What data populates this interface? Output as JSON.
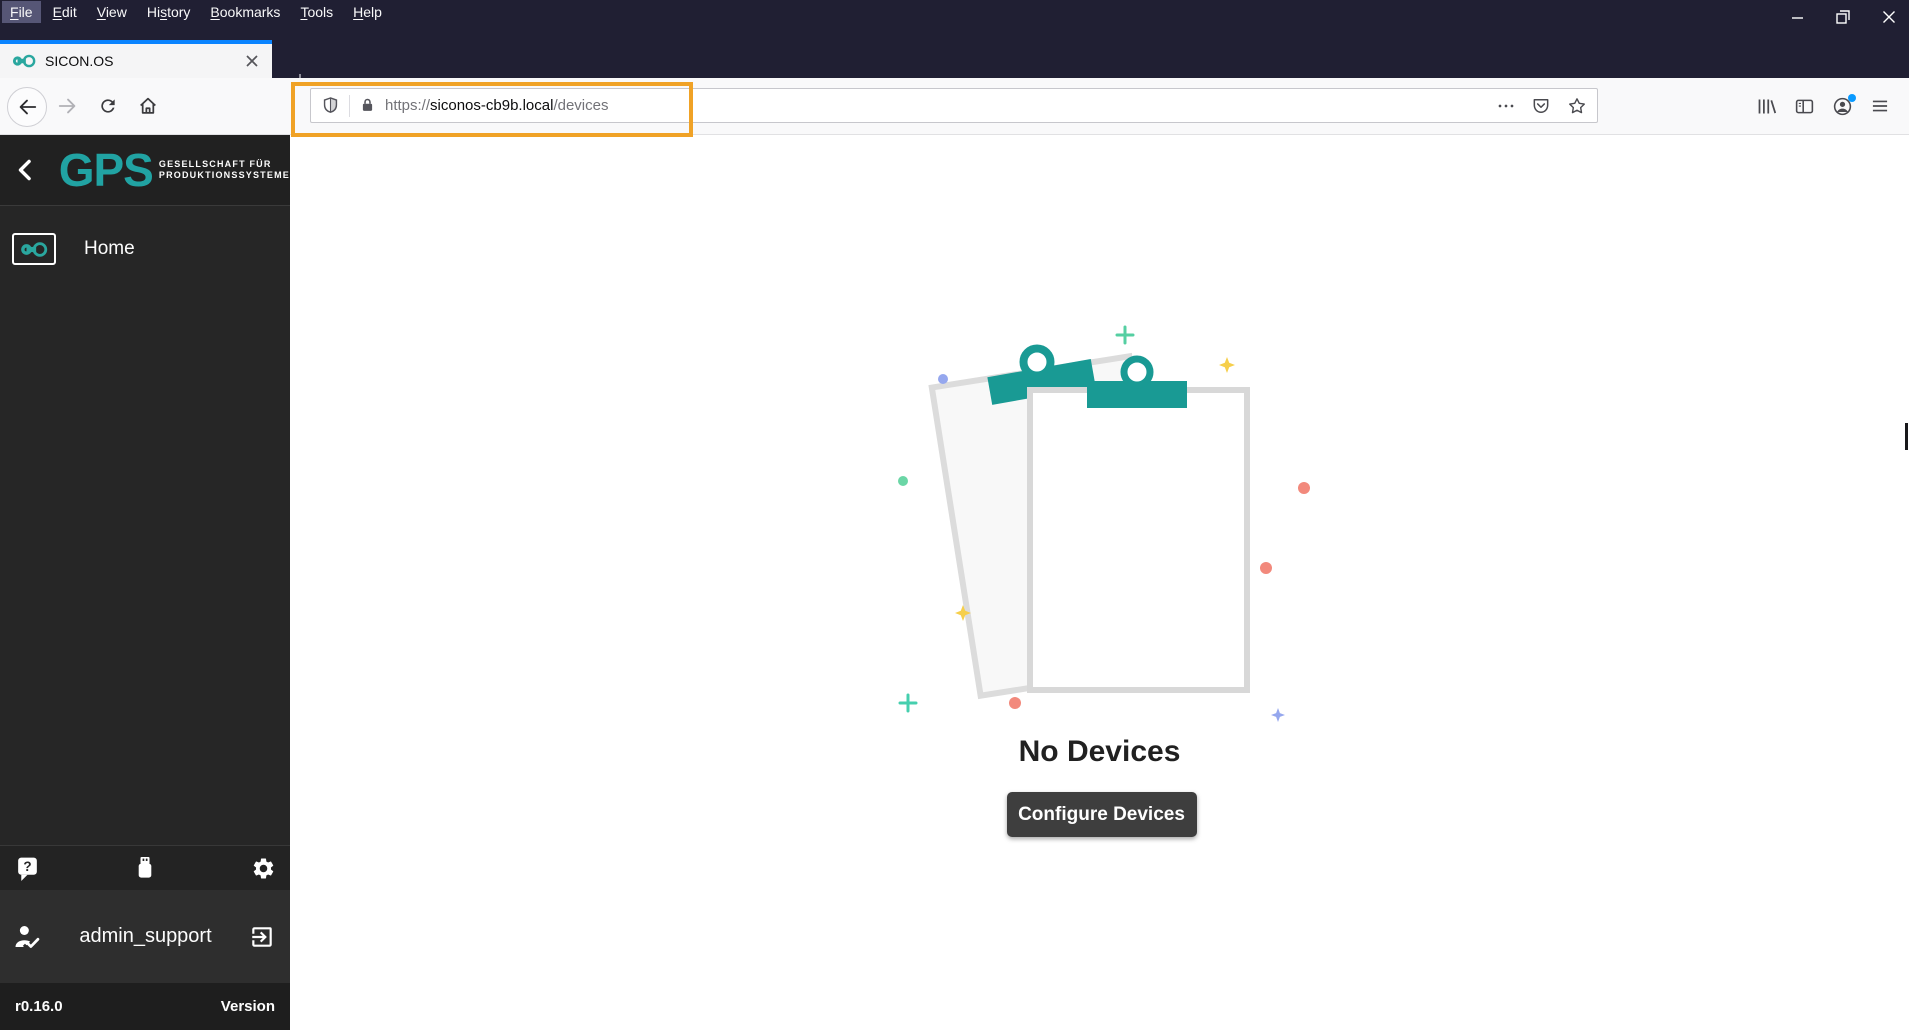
{
  "menubar": {
    "items": [
      {
        "label": "File",
        "key_index": 0,
        "active": true
      },
      {
        "label": "Edit",
        "key_index": 0
      },
      {
        "label": "View",
        "key_index": 0
      },
      {
        "label": "History",
        "key_index": 2
      },
      {
        "label": "Bookmarks",
        "key_index": 0
      },
      {
        "label": "Tools",
        "key_index": 0
      },
      {
        "label": "Help",
        "key_index": 0
      }
    ]
  },
  "tab": {
    "title": "SICON.OS"
  },
  "urlbar": {
    "protocol": "https://",
    "domain": "siconos-cb9b.local",
    "path": "/devices"
  },
  "sidebar": {
    "logo": {
      "acronym": "GPS",
      "subtitle_line1": "GESELLSCHAFT FÜR",
      "subtitle_line2": "PRODUKTIONSSYSTEME"
    },
    "nav": [
      {
        "label": "Home"
      }
    ],
    "user": {
      "name": "admin_support"
    },
    "version": {
      "value": "r0.16.0",
      "label": "Version"
    }
  },
  "content": {
    "empty_state": {
      "title": "No Devices",
      "button_label": "Configure Devices"
    }
  },
  "colors": {
    "accent_teal": "#21a3a3",
    "clip_teal": "#199a94",
    "annotation_orange": "#f0a226",
    "active_tab_stripe": "#0a84ff",
    "notification_blue": "#0a9aff",
    "button_dark": "#3e3e3e",
    "sidebar_bg": "#262626",
    "chrome_bg": "#201f33"
  }
}
